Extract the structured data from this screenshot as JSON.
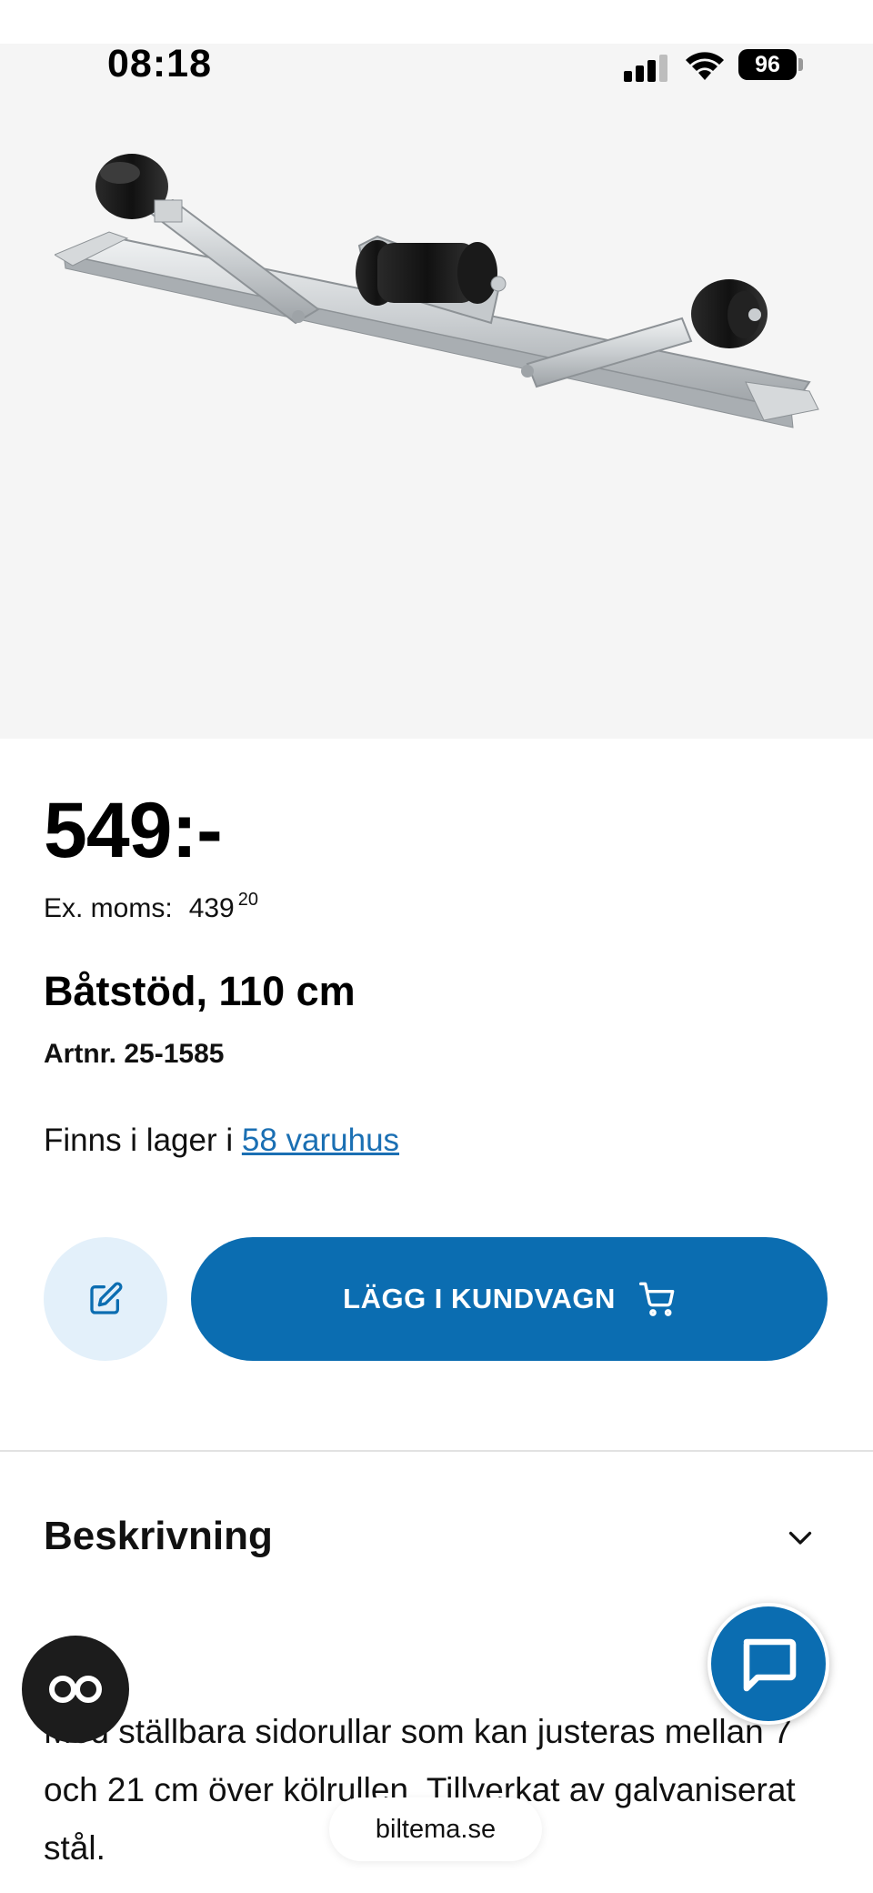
{
  "status": {
    "time": "08:18",
    "battery": "96"
  },
  "product": {
    "price": "549:-",
    "exmoms_label": "Ex. moms:",
    "exmoms_whole": "439",
    "exmoms_fraction": "20",
    "title": "Båtstöd, 110 cm",
    "artnr": "Artnr. 25-1585",
    "stock_prefix": "Finns i lager i ",
    "stock_link": "58 varuhus"
  },
  "actions": {
    "add_to_cart": "LÄGG I KUNDVAGN"
  },
  "description": {
    "heading": "Beskrivning",
    "text": "Med ställbara sidorullar som kan justeras mellan 7 och 21 cm över kölrullen. Tillverkat av galvaniserat stål."
  },
  "browser": {
    "url": "biltema.se"
  },
  "colors": {
    "brand_blue": "#0b6db1",
    "link": "#1a6fb3",
    "hero_bg": "#f5f5f5"
  },
  "icons": [
    "signal-icon",
    "wifi-icon",
    "battery-icon",
    "edit-note-icon",
    "cart-icon",
    "chevron-down-icon",
    "chat-icon",
    "glasses-icon"
  ]
}
